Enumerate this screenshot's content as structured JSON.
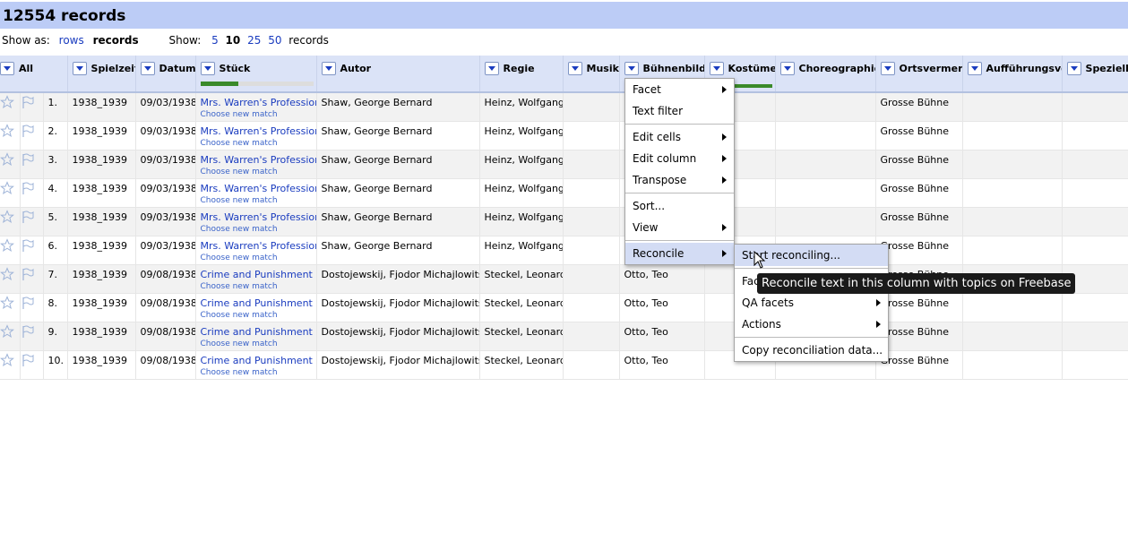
{
  "summary": {
    "title": "12554 records"
  },
  "viewbar": {
    "show_as_label": "Show as:",
    "rows_label": "rows",
    "records_label": "records",
    "show_label": "Show:",
    "page_sizes": [
      "5",
      "10",
      "25",
      "50"
    ],
    "page_size_selected": "10",
    "records_suffix": "records"
  },
  "columns": [
    "All",
    "Spielzeit",
    "Datum",
    "Stück",
    "Autor",
    "Regie",
    "Musik",
    "Bühnenbild",
    "Kostüme",
    "Choreographie",
    "Ortsvermerk",
    "Aufführungsver",
    "Spezielle"
  ],
  "stuck_reconcile_progress": 0.34,
  "choose_match_label": "Choose new match",
  "rows": [
    {
      "n": "1.",
      "spielzeit": "1938_1939",
      "datum": "09/03/1938",
      "stuck": "Mrs. Warren's Profession",
      "autor": "Shaw, George Bernard",
      "regie": "Heinz, Wolfgang",
      "bb": "",
      "ort": "Grosse Bühne"
    },
    {
      "n": "2.",
      "spielzeit": "1938_1939",
      "datum": "09/03/1938",
      "stuck": "Mrs. Warren's Profession",
      "autor": "Shaw, George Bernard",
      "regie": "Heinz, Wolfgang",
      "bb": "",
      "ort": "Grosse Bühne"
    },
    {
      "n": "3.",
      "spielzeit": "1938_1939",
      "datum": "09/03/1938",
      "stuck": "Mrs. Warren's Profession",
      "autor": "Shaw, George Bernard",
      "regie": "Heinz, Wolfgang",
      "bb": "",
      "ort": "Grosse Bühne"
    },
    {
      "n": "4.",
      "spielzeit": "1938_1939",
      "datum": "09/03/1938",
      "stuck": "Mrs. Warren's Profession",
      "autor": "Shaw, George Bernard",
      "regie": "Heinz, Wolfgang",
      "bb": "",
      "ort": "Grosse Bühne"
    },
    {
      "n": "5.",
      "spielzeit": "1938_1939",
      "datum": "09/03/1938",
      "stuck": "Mrs. Warren's Profession",
      "autor": "Shaw, George Bernard",
      "regie": "Heinz, Wolfgang",
      "bb": "",
      "ort": "Grosse Bühne"
    },
    {
      "n": "6.",
      "spielzeit": "1938_1939",
      "datum": "09/03/1938",
      "stuck": "Mrs. Warren's Profession",
      "autor": "Shaw, George Bernard",
      "regie": "Heinz, Wolfgang",
      "bb": "",
      "ort": "Grosse Bühne"
    },
    {
      "n": "7.",
      "spielzeit": "1938_1939",
      "datum": "09/08/1938",
      "stuck": "Crime and Punishment",
      "autor": "Dostojewskij, Fjodor Michajlowitsch",
      "regie": "Steckel, Leonard",
      "bb": "Otto, Teo",
      "ort": "Grosse Bühne"
    },
    {
      "n": "8.",
      "spielzeit": "1938_1939",
      "datum": "09/08/1938",
      "stuck": "Crime and Punishment",
      "autor": "Dostojewskij, Fjodor Michajlowitsch",
      "regie": "Steckel, Leonard",
      "bb": "Otto, Teo",
      "ort": "Grosse Bühne"
    },
    {
      "n": "9.",
      "spielzeit": "1938_1939",
      "datum": "09/08/1938",
      "stuck": "Crime and Punishment",
      "autor": "Dostojewskij, Fjodor Michajlowitsch",
      "regie": "Steckel, Leonard",
      "bb": "Otto, Teo",
      "ort": "Grosse Bühne"
    },
    {
      "n": "10.",
      "spielzeit": "1938_1939",
      "datum": "09/08/1938",
      "stuck": "Crime and Punishment",
      "autor": "Dostojewskij, Fjodor Michajlowitsch",
      "regie": "Steckel, Leonard",
      "bb": "Otto, Teo",
      "ort": "Grosse Bühne"
    }
  ],
  "column_menu": {
    "facet": "Facet",
    "text_filter": "Text filter",
    "edit_cells": "Edit cells",
    "edit_column": "Edit column",
    "transpose": "Transpose",
    "sort": "Sort...",
    "view": "View",
    "reconcile": "Reconcile"
  },
  "reconcile_menu": {
    "start": "Start reconciling...",
    "facets": "Facets",
    "qa_facets": "QA facets",
    "actions": "Actions",
    "copy": "Copy reconciliation data..."
  },
  "tooltip": "Reconcile text in this column with topics on Freebase",
  "colors": {
    "header_bg": "#bcccf6",
    "link": "#1a3cbf",
    "progress": "#3a8a2a"
  }
}
